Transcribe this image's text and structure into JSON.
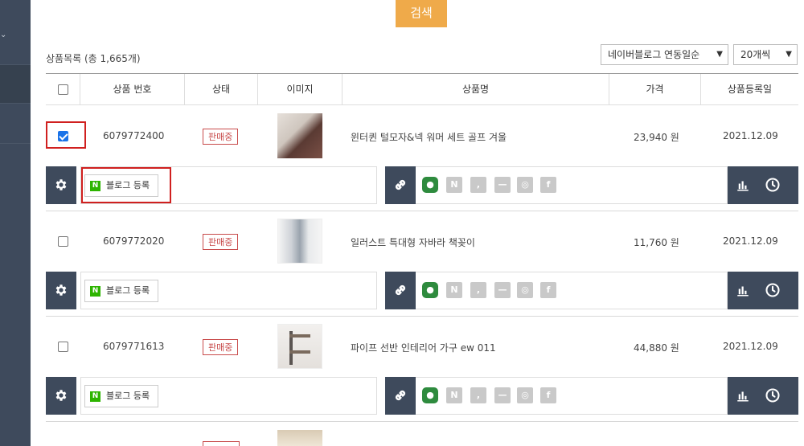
{
  "search": {
    "label": "검색"
  },
  "list": {
    "title": "상품목록 (총 1,665개)"
  },
  "filters": {
    "sort_selected": "네이버블로그 연동일순",
    "page_size_selected": "20개씩"
  },
  "table": {
    "headers": [
      "상품 번호",
      "상태",
      "이미지",
      "상품명",
      "가격",
      "상품등록일"
    ]
  },
  "rows": [
    {
      "checked": true,
      "id": "6079772400",
      "status": "판매중",
      "name": "윈터퀸 털모자&넥 워머 세트 골프 겨울",
      "price": "23,940 원",
      "date": "2021.12.09",
      "blog_label": "블로그 등록"
    },
    {
      "checked": false,
      "id": "6079772020",
      "status": "판매중",
      "name": "일러스트 특대형 자바라 책꽂이",
      "price": "11,760 원",
      "date": "2021.12.09",
      "blog_label": "블로그 등록"
    },
    {
      "checked": false,
      "id": "6079771613",
      "status": "판매중",
      "name": "파이프 선반 인테리어 가구 ew 011",
      "price": "44,880 원",
      "date": "2021.12.09",
      "blog_label": "블로그 등록"
    }
  ],
  "icons": {
    "gear": "gear-icon",
    "link": "link-icon",
    "stats": "bar-chart-icon",
    "history": "clock-icon",
    "social": [
      "hexagon-icon",
      "naver-icon",
      "comma-icon",
      "mail-icon",
      "instagram-icon",
      "facebook-icon"
    ]
  },
  "colors": {
    "accent": "#efaa4a",
    "dark": "#3e4a5c",
    "status": "#c84b4b",
    "highlight": "#d0201f"
  }
}
